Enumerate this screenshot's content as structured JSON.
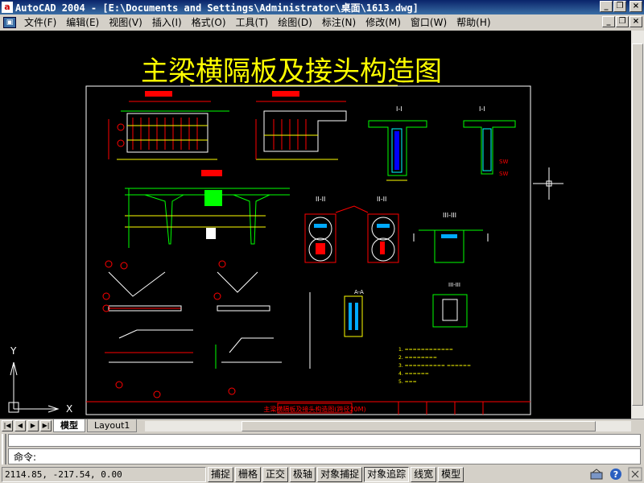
{
  "window": {
    "title": "AutoCAD 2004 - [E:\\Documents and Settings\\Administrator\\桌面\\1613.dwg]",
    "app_icon": "autocad-icon",
    "controls": [
      "minimize-icon",
      "restore-icon",
      "close-icon"
    ]
  },
  "menu": {
    "items": [
      "文件(F)",
      "编辑(E)",
      "视图(V)",
      "插入(I)",
      "格式(O)",
      "工具(T)",
      "绘图(D)",
      "标注(N)",
      "修改(M)",
      "窗口(W)",
      "帮助(H)"
    ]
  },
  "drawing": {
    "title": "主梁横隔板及接头构造图",
    "title_color": "#ffff00",
    "frame_color": "#ffffff",
    "accent_red": "#ff0000",
    "accent_green": "#00ff00",
    "accent_cyan": "#00ffff",
    "section_labels": [
      "I-I",
      "II-II",
      "III-III",
      "III-III",
      "II-II",
      "I-I"
    ],
    "title_block": "主梁横隔板及接头构造图(跨径20M)",
    "ucs": {
      "x_label": "X",
      "y_label": "Y"
    }
  },
  "tabs": {
    "nav": [
      "first-icon",
      "prev-icon",
      "next-icon",
      "last-icon"
    ],
    "items": [
      "模型",
      "Layout1"
    ],
    "active": "模型"
  },
  "command": {
    "prompt": "命令:"
  },
  "status": {
    "coords": "2114.85, -217.54, 0.00",
    "buttons": [
      {
        "label": "捕捉",
        "on": false
      },
      {
        "label": "栅格",
        "on": false
      },
      {
        "label": "正交",
        "on": false
      },
      {
        "label": "极轴",
        "on": false
      },
      {
        "label": "对象捕捉",
        "on": false
      },
      {
        "label": "对象追踪",
        "on": true
      },
      {
        "label": "线宽",
        "on": false
      },
      {
        "label": "模型",
        "on": false
      }
    ],
    "tray_icons": [
      "communication-center-icon",
      "help-icon",
      "tray-settings-icon"
    ]
  }
}
